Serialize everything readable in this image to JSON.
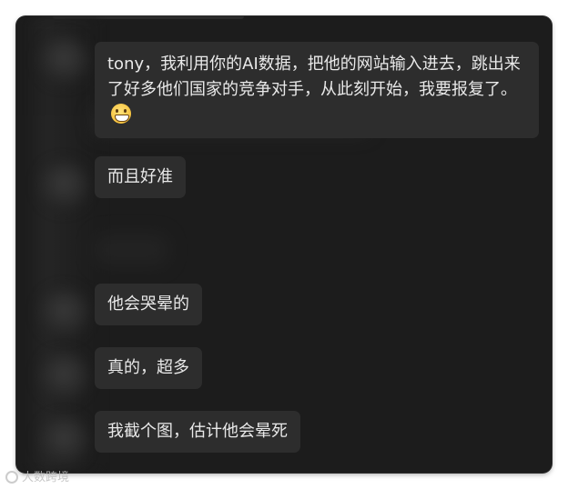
{
  "messages": [
    {
      "text": "tony，我利用你的AI数据，把他的网站输入进去，跳出来了好多他们国家的竞争对手，从此刻开始，我要报复了。",
      "emoji": "grimacing-face"
    },
    {
      "text": "而且好准"
    },
    {
      "text": "他会哭晕的"
    },
    {
      "text": "真的，超多"
    },
    {
      "text": "我截个图，估计他会晕死"
    }
  ],
  "watermark": {
    "text": "大数跨境",
    "icon": "weibo-logo-icon"
  },
  "colors": {
    "background": "#1c1c1c",
    "bubble": "#2d2d2d",
    "text": "#e9e9e9"
  }
}
